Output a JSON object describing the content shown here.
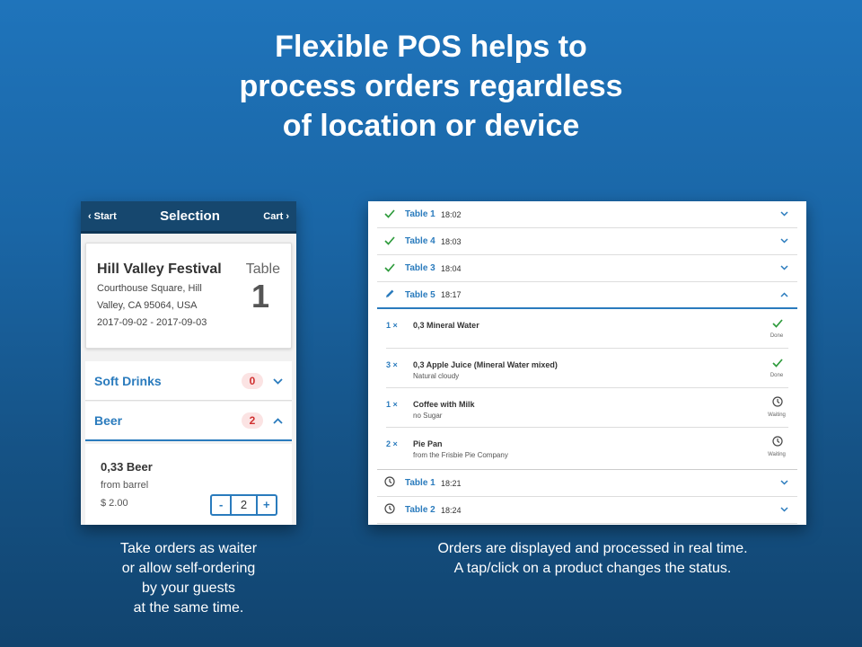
{
  "headline": [
    "Flexible POS helps to",
    "process orders regardless",
    "of location or device"
  ],
  "phone": {
    "nav": {
      "back_label": "Start",
      "title": "Selection",
      "cart_label": "Cart"
    },
    "event": {
      "name": "Hill Valley Festival",
      "address_line1": "Courthouse Square, Hill",
      "address_line2": "Valley, CA 95064, USA",
      "dates": "2017-09-02 - 2017-09-03",
      "table_label": "Table",
      "table_number": "1"
    },
    "categories": [
      {
        "name": "Soft Drinks",
        "count": "0",
        "expanded": false
      },
      {
        "name": "Beer",
        "count": "2",
        "expanded": true
      }
    ],
    "product": {
      "name": "0,33 Beer",
      "description": "from barrel",
      "price": "$ 2.00",
      "minus": "-",
      "quantity": "2",
      "plus": "+"
    }
  },
  "orders": {
    "rows_before": [
      {
        "status": "done",
        "table": "Table 1",
        "time": "18:02"
      },
      {
        "status": "done",
        "table": "Table 4",
        "time": "18:03"
      },
      {
        "status": "done",
        "table": "Table 3",
        "time": "18:04"
      }
    ],
    "open_row": {
      "status": "editing",
      "table": "Table 5",
      "time": "18:17"
    },
    "items": [
      {
        "qty": "1 ×",
        "name": "0,3 Mineral Water",
        "note": "",
        "status": "Done"
      },
      {
        "qty": "3 ×",
        "name": "0,3 Apple Juice (Mineral Water mixed)",
        "note": "Natural cloudy",
        "status": "Done"
      },
      {
        "qty": "1 ×",
        "name": "Coffee with Milk",
        "note": "no Sugar",
        "status": "Waiting"
      },
      {
        "qty": "2 ×",
        "name": "Pie Pan",
        "note": "from the Frisbie Pie Company",
        "status": "Waiting"
      }
    ],
    "rows_after": [
      {
        "status": "waiting",
        "table": "Table 1",
        "time": "18:21"
      },
      {
        "status": "waiting",
        "table": "Table 2",
        "time": "18:24"
      }
    ]
  },
  "captions": {
    "left": [
      "Take orders as waiter",
      "or allow self-ordering",
      "by your guests",
      "at the same time."
    ],
    "right": [
      "Orders are displayed and processed in real time.",
      "A tap/click on a product changes the status."
    ]
  },
  "colors": {
    "accent": "#2a7bbd",
    "nav": "#16476e",
    "done": "#2e9b3c",
    "badge": "#d03030"
  }
}
